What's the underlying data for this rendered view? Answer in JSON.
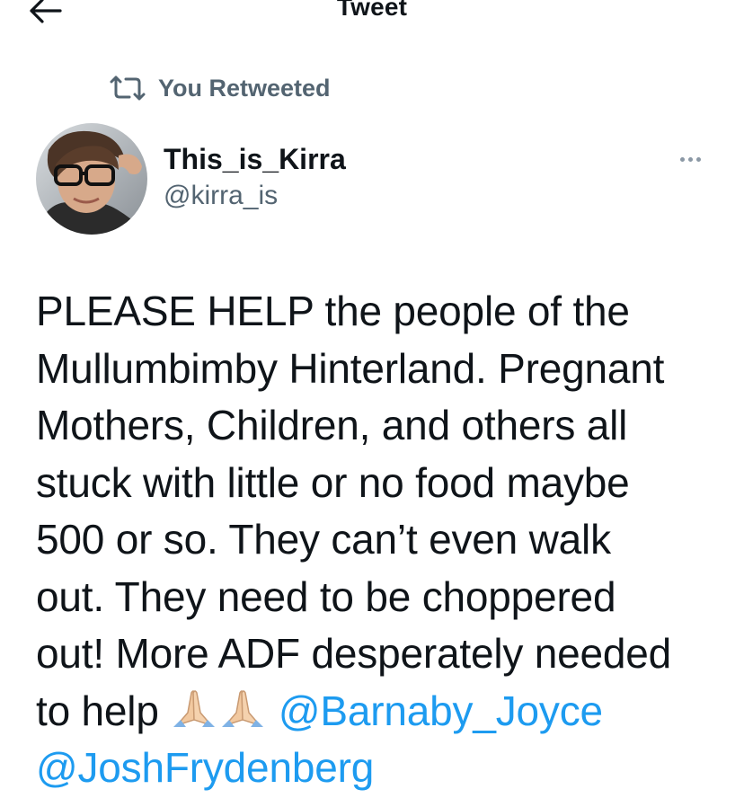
{
  "header": {
    "title": "Tweet",
    "back_icon": "arrow-left-icon"
  },
  "retweet_context": {
    "icon": "retweet-icon",
    "label": "You Retweeted"
  },
  "author": {
    "display_name": "This_is_Kirra",
    "handle": "@kirra_is",
    "avatar": "profile-photo"
  },
  "more_icon": "more-horizontal-icon",
  "tweet": {
    "text_lines": [
      "PLEASE HELP the people of the",
      "Mullumbimby Hinterland. Pregnant",
      "Mothers, Children, and others all",
      "stuck with little or no food maybe",
      "500 or so. They can’t even walk",
      "out. They need to be choppered",
      "out! More ADF desperately needed"
    ],
    "last_line_prefix": "to help",
    "emojis": [
      "folded-hands-emoji",
      "folded-hands-emoji"
    ],
    "mentions": [
      "@Barnaby_Joyce",
      "@JoshFrydenberg"
    ]
  },
  "colors": {
    "text": "#0f1419",
    "secondary": "#536471",
    "link": "#1d9bf0",
    "background": "#ffffff"
  }
}
